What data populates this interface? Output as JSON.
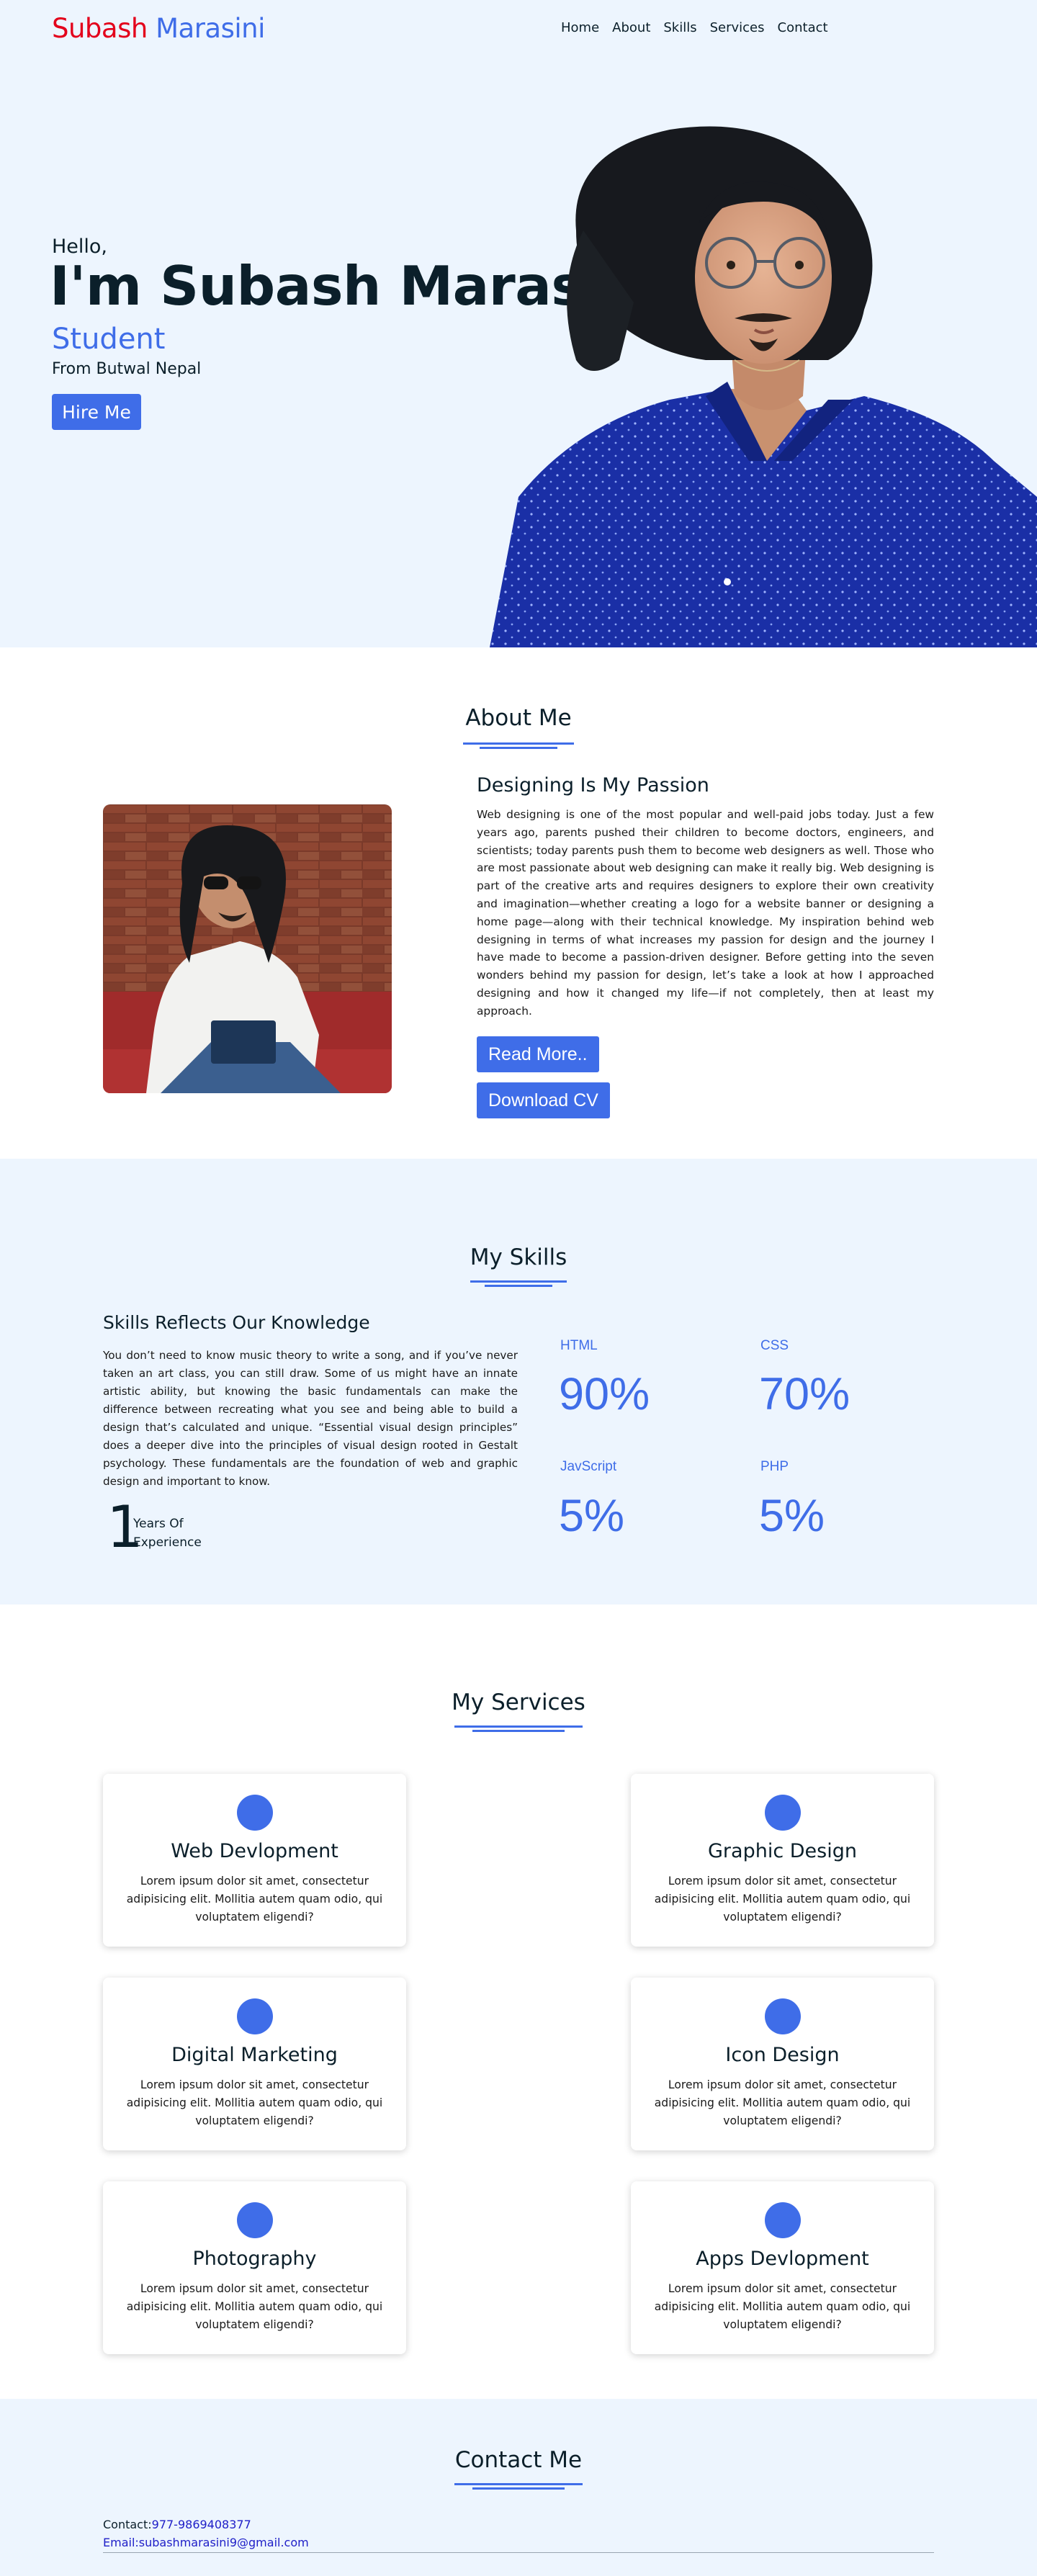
{
  "nav": {
    "logo_first": "Subash",
    "logo_last": "Marasini",
    "links": [
      "Home",
      "About",
      "Skills",
      "Services",
      "Contact"
    ]
  },
  "hero": {
    "greeting": "Hello,",
    "name": "I'm Subash Marasini",
    "role": "Student",
    "location": "From Butwal Nepal",
    "cta": "Hire Me"
  },
  "about": {
    "title": "About Me",
    "heading": "Designing Is My Passion",
    "paragraph": "Web designing is one of the most popular and well-paid jobs today. Just a few years ago, parents pushed their children to become doctors, engineers, and scientists; today parents push them to become web designers as well. Those who are most passionate about web designing can make it really big. Web designing is part of the creative arts and requires designers to explore their own creativity and imagination—whether creating a logo for a website banner or designing a home page—along with their technical knowledge. My inspiration behind web designing in terms of what increases my passion for design and the journey I have made to become a passion-driven designer. Before getting into the seven wonders behind my passion for design, let’s take a look at how I approached designing and how it changed my life—if not completely, then at least my approach.",
    "read_more": "Read More..",
    "download_cv": "Download CV"
  },
  "skills": {
    "title": "My Skills",
    "heading": "Skills Reflects Our Knowledge",
    "paragraph": "You don’t need to know music theory to write a song, and if you’ve never taken an art class, you can still draw. Some of us might have an innate artistic ability, but knowing the basic fundamentals can make the difference between recreating what you see and being able to build a design that’s calculated and unique. “Essential visual design principles” does a deeper dive into the principles of visual design rooted in Gestalt psychology. These fundamentals are the foundation of web and graphic design and important to know.",
    "years_number": "1",
    "years_line1": "Years Of",
    "years_line2": "Experience",
    "items": [
      {
        "name": "HTML",
        "value": "90%"
      },
      {
        "name": "CSS",
        "value": "70%"
      },
      {
        "name": "JavScript",
        "value": "5%"
      },
      {
        "name": "PHP",
        "value": "5%"
      }
    ]
  },
  "services": {
    "title": "My Services",
    "items": [
      {
        "title": "Web Devlopment",
        "desc": "Lorem ipsum dolor sit amet, consectetur adipisicing elit. Mollitia autem quam odio, qui voluptatem eligendi?"
      },
      {
        "title": "Graphic Design",
        "desc": "Lorem ipsum dolor sit amet, consectetur adipisicing elit. Mollitia autem quam odio, qui voluptatem eligendi?"
      },
      {
        "title": "Digital Marketing",
        "desc": "Lorem ipsum dolor sit amet, consectetur adipisicing elit. Mollitia autem quam odio, qui voluptatem eligendi?"
      },
      {
        "title": "Icon Design",
        "desc": "Lorem ipsum dolor sit amet, consectetur adipisicing elit. Mollitia autem quam odio, qui voluptatem eligendi?"
      },
      {
        "title": "Photography",
        "desc": "Lorem ipsum dolor sit amet, consectetur adipisicing elit. Mollitia autem quam odio, qui voluptatem eligendi?"
      },
      {
        "title": "Apps Devlopment",
        "desc": "Lorem ipsum dolor sit amet, consectetur adipisicing elit. Mollitia autem quam odio, qui voluptatem eligendi?"
      }
    ]
  },
  "contact": {
    "title": "Contact Me",
    "phone_label": "Contact:",
    "phone": "977-9869408377",
    "email_label": "Email:",
    "email": "subashmarasini9@gmail.com"
  },
  "colors": {
    "accent": "#3f6de8",
    "logo_red": "#e3001b",
    "light_bg": "#edf5fe",
    "dark_text": "#0b1f2a"
  }
}
